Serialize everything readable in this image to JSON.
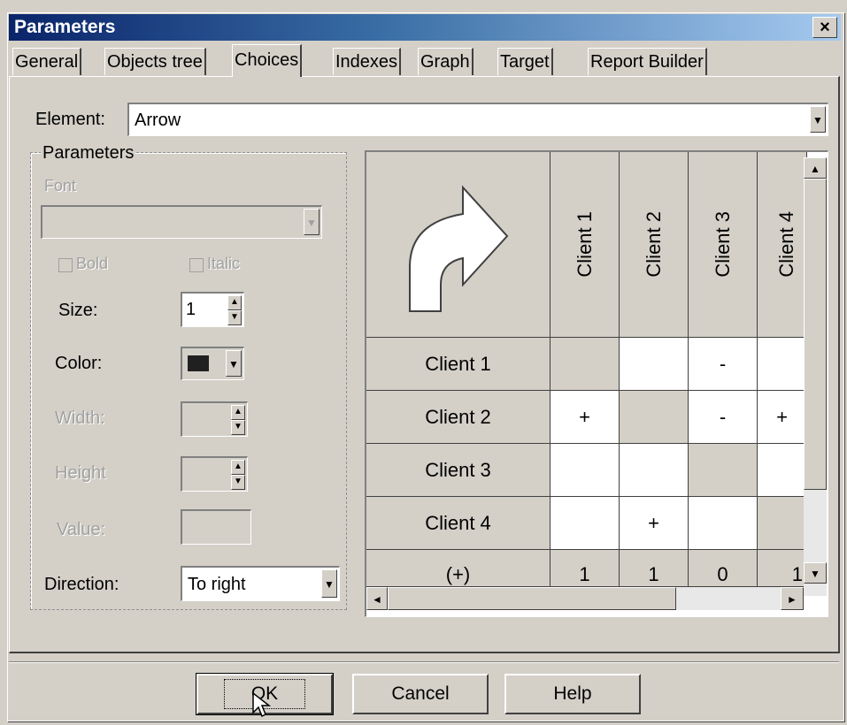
{
  "window": {
    "title": "Parameters",
    "close_glyph": "×"
  },
  "tabs": [
    {
      "label": "General",
      "active": false
    },
    {
      "label": "Objects tree",
      "active": false
    },
    {
      "label": "Choices",
      "active": true
    },
    {
      "label": "Indexes",
      "active": false
    },
    {
      "label": "Graph",
      "active": false
    },
    {
      "label": "Target",
      "active": false
    },
    {
      "label": "Report Builder",
      "active": false
    }
  ],
  "element": {
    "label": "Element:",
    "value": "Arrow"
  },
  "params": {
    "group_label": "Parameters",
    "font_label": "Font",
    "font_value": "",
    "bold_label": "Bold",
    "italic_label": "Italic",
    "size_label": "Size:",
    "size_value": "1",
    "color_label": "Color:",
    "color_value": "#202020",
    "width_label": "Width:",
    "height_label": "Height",
    "value_label": "Value:",
    "direction_label": "Direction:",
    "direction_value": "To right"
  },
  "matrix": {
    "columns": [
      "Client 1",
      "Client 2",
      "Client 3",
      "Client 4"
    ],
    "rows": [
      {
        "label": "Client 1",
        "cells": [
          "",
          "",
          "-",
          ""
        ]
      },
      {
        "label": "Client 2",
        "cells": [
          "+",
          "",
          "-",
          "+"
        ]
      },
      {
        "label": "Client 3",
        "cells": [
          "",
          "",
          "",
          ""
        ]
      },
      {
        "label": "Client 4",
        "cells": [
          "",
          "+",
          "",
          ""
        ]
      }
    ],
    "total_label": "(+)",
    "totals": [
      "1",
      "1",
      "0",
      "1"
    ]
  },
  "buttons": {
    "ok": "OK",
    "cancel": "Cancel",
    "help": "Help"
  }
}
